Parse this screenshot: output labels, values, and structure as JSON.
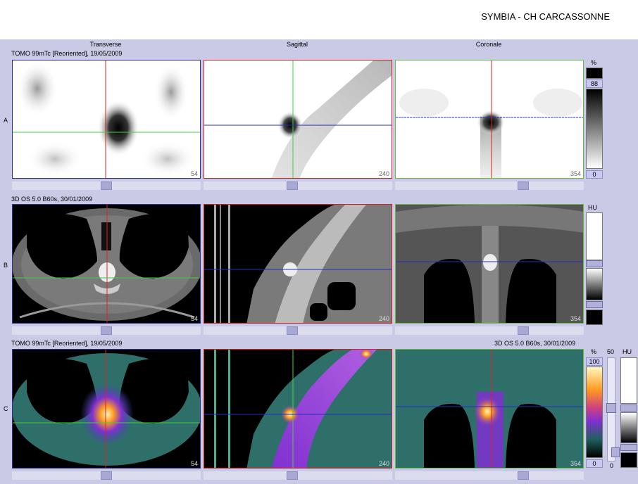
{
  "header": {
    "site_title": "SYMBIA - CH CARCASSONNE"
  },
  "columns": {
    "transverse": "Transverse",
    "sagittal": "Sagittal",
    "coronal": "Coronale"
  },
  "rows": {
    "a": {
      "letter": "A",
      "caption": "TOMO 99mTc [Reoriented], 19/05/2009"
    },
    "b": {
      "letter": "B",
      "caption": "3D  OS  5.0  B60s, 30/01/2009"
    },
    "c": {
      "letter": "C",
      "caption_left": "TOMO 99mTc [Reoriented], 19/05/2009",
      "caption_right": "3D  OS  5.0  B60s, 30/01/2009"
    }
  },
  "slices": {
    "transverse": "54",
    "sagittal": "240",
    "coronal": "354"
  },
  "colorbars": {
    "a": {
      "unit": "%",
      "top_value": "88",
      "bottom_value": "0"
    },
    "b": {
      "unit": "HU"
    },
    "c": {
      "unit_pct": "%",
      "pct_top": "100",
      "pct_bottom": "0",
      "unit_hu": "HU",
      "fusion_top": "50",
      "fusion_bottom": "0"
    }
  },
  "colors": {
    "crosshair_vertical_transverse": "#e02020",
    "crosshair_horizontal_transverse": "#40d040",
    "crosshair_sagittal_v": "#40d040",
    "crosshair_sagittal_h": "#2030c0",
    "crosshair_coronal_v": "#e02020",
    "crosshair_coronal_h": "#2030c0",
    "frame_transverse": "#303090",
    "frame_sagittal": "#d02020",
    "frame_coronal": "#60c040",
    "pet_hot": "#ff9a20",
    "pet_purple": "#8030d0",
    "pet_teal": "#30a0a0"
  }
}
